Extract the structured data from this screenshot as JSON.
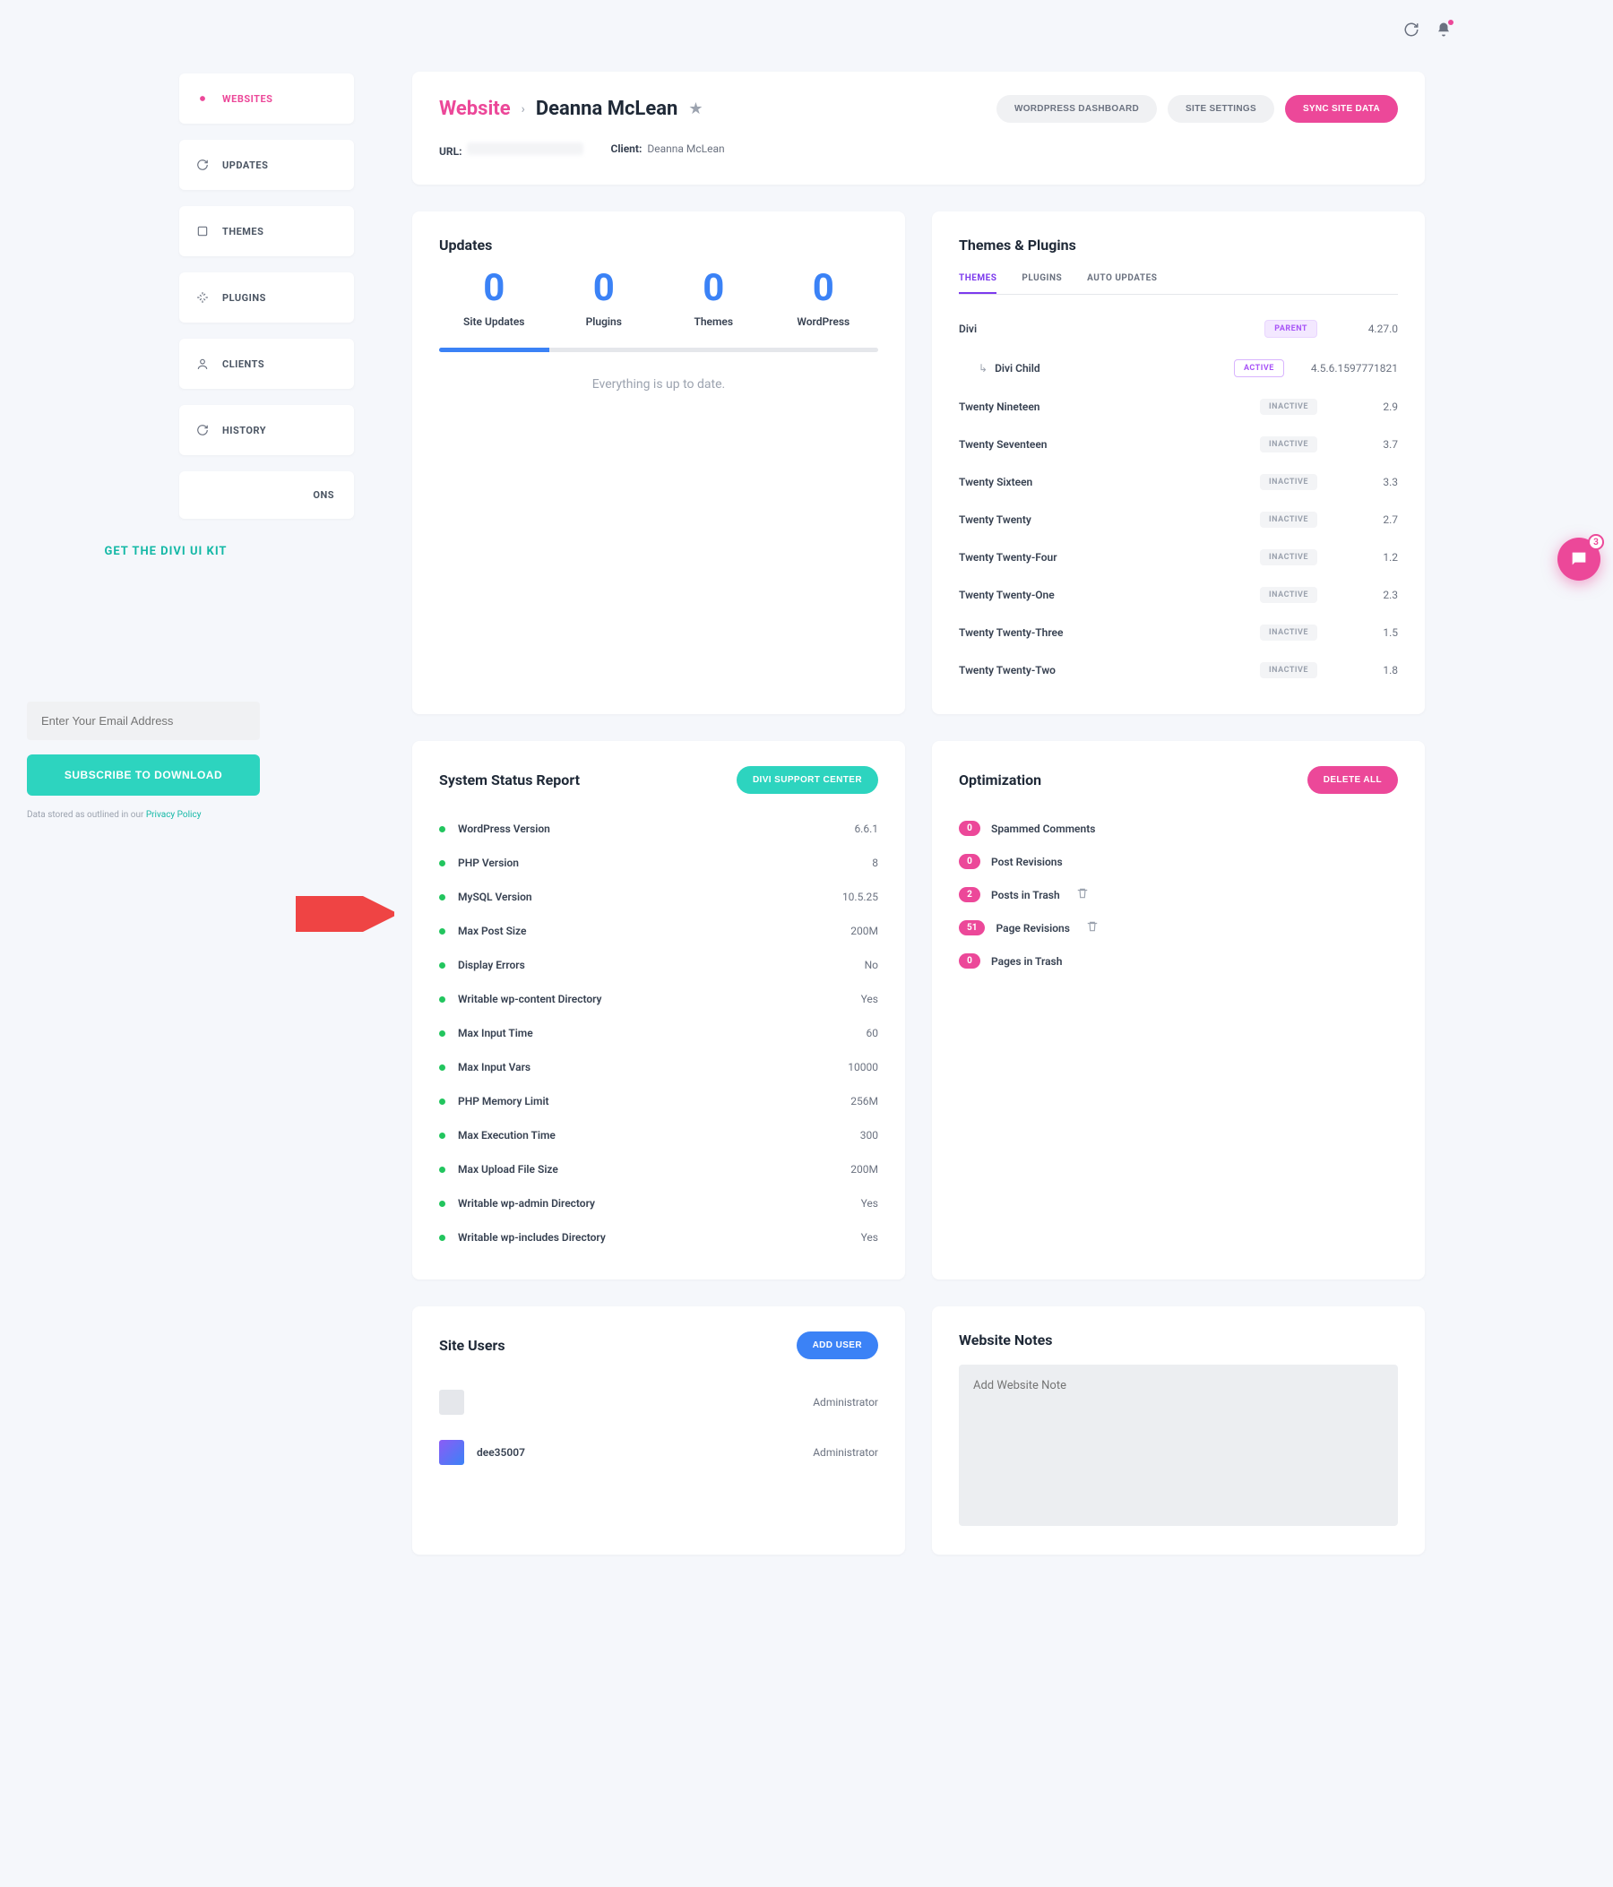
{
  "promo": {
    "title": "GET THE DIVI UI KIT",
    "email_placeholder": "Enter Your Email Address",
    "subscribe": "SUBSCRIBE TO DOWNLOAD",
    "policy_prefix": "Data stored as outlined in our ",
    "policy_link": "Privacy Policy"
  },
  "sidebar": {
    "items": [
      {
        "label": "WEBSITES",
        "active": true
      },
      {
        "label": "UPDATES"
      },
      {
        "label": "THEMES"
      },
      {
        "label": "PLUGINS"
      },
      {
        "label": "CLIENTS"
      },
      {
        "label": "HISTORY"
      }
    ],
    "partial": "ONS"
  },
  "header": {
    "breadcrumb_root": "Website",
    "current": "Deanna McLean",
    "url_label": "URL:",
    "client_label": "Client:",
    "client_name": "Deanna McLean",
    "actions": {
      "dashboard": "WORDPRESS DASHBOARD",
      "settings": "SITE SETTINGS",
      "sync": "SYNC SITE DATA"
    }
  },
  "updates": {
    "title": "Updates",
    "items": [
      {
        "count": "0",
        "label": "Site Updates"
      },
      {
        "count": "0",
        "label": "Plugins"
      },
      {
        "count": "0",
        "label": "Themes"
      },
      {
        "count": "0",
        "label": "WordPress"
      }
    ],
    "message": "Everything is up to date."
  },
  "themes_plugins": {
    "title": "Themes & Plugins",
    "tabs": [
      "THEMES",
      "PLUGINS",
      "AUTO UPDATES"
    ],
    "rows": [
      {
        "name": "Divi",
        "badge": "PARENT",
        "badge_class": "badge-parent",
        "version": "4.27.0"
      },
      {
        "name": "Divi Child",
        "child": true,
        "badge": "ACTIVE",
        "badge_class": "badge-active",
        "version": "4.5.6.1597771821"
      },
      {
        "name": "Twenty Nineteen",
        "badge": "INACTIVE",
        "badge_class": "badge-inactive",
        "version": "2.9"
      },
      {
        "name": "Twenty Seventeen",
        "badge": "INACTIVE",
        "badge_class": "badge-inactive",
        "version": "3.7"
      },
      {
        "name": "Twenty Sixteen",
        "badge": "INACTIVE",
        "badge_class": "badge-inactive",
        "version": "3.3"
      },
      {
        "name": "Twenty Twenty",
        "badge": "INACTIVE",
        "badge_class": "badge-inactive",
        "version": "2.7"
      },
      {
        "name": "Twenty Twenty-Four",
        "badge": "INACTIVE",
        "badge_class": "badge-inactive",
        "version": "1.2"
      },
      {
        "name": "Twenty Twenty-One",
        "badge": "INACTIVE",
        "badge_class": "badge-inactive",
        "version": "2.3"
      },
      {
        "name": "Twenty Twenty-Three",
        "badge": "INACTIVE",
        "badge_class": "badge-inactive",
        "version": "1.5"
      },
      {
        "name": "Twenty Twenty-Two",
        "badge": "INACTIVE",
        "badge_class": "badge-inactive",
        "version": "1.8"
      }
    ]
  },
  "status": {
    "title": "System Status Report",
    "button": "DIVI SUPPORT CENTER",
    "rows": [
      {
        "name": "WordPress Version",
        "value": "6.6.1"
      },
      {
        "name": "PHP Version",
        "value": "8"
      },
      {
        "name": "MySQL Version",
        "value": "10.5.25"
      },
      {
        "name": "Max Post Size",
        "value": "200M"
      },
      {
        "name": "Display Errors",
        "value": "No"
      },
      {
        "name": "Writable wp-content Directory",
        "value": "Yes"
      },
      {
        "name": "Max Input Time",
        "value": "60"
      },
      {
        "name": "Max Input Vars",
        "value": "10000"
      },
      {
        "name": "PHP Memory Limit",
        "value": "256M"
      },
      {
        "name": "Max Execution Time",
        "value": "300"
      },
      {
        "name": "Max Upload File Size",
        "value": "200M"
      },
      {
        "name": "Writable wp-admin Directory",
        "value": "Yes"
      },
      {
        "name": "Writable wp-includes Directory",
        "value": "Yes"
      }
    ]
  },
  "optimization": {
    "title": "Optimization",
    "button": "DELETE ALL",
    "rows": [
      {
        "count": "0",
        "name": "Spammed Comments"
      },
      {
        "count": "0",
        "name": "Post Revisions"
      },
      {
        "count": "2",
        "name": "Posts in Trash",
        "trash": true
      },
      {
        "count": "51",
        "name": "Page Revisions",
        "trash": true
      },
      {
        "count": "0",
        "name": "Pages in Trash"
      }
    ]
  },
  "users": {
    "title": "Site Users",
    "button": "ADD USER",
    "rows": [
      {
        "name": "",
        "blurred": true,
        "role": "Administrator"
      },
      {
        "name": "dee35007",
        "role": "Administrator",
        "img": true
      }
    ]
  },
  "notes": {
    "title": "Website Notes",
    "placeholder": "Add Website Note"
  },
  "chat": {
    "count": "3"
  }
}
